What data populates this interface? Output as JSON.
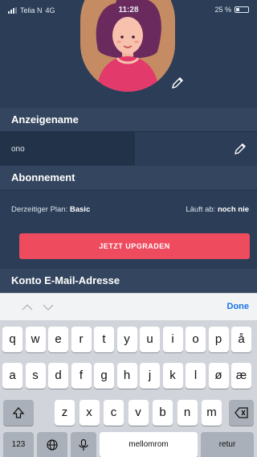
{
  "status": {
    "carrier": "Telia N",
    "network": "4G",
    "time": "11:28",
    "battery_pct": "25 %",
    "battery_level": 0.25
  },
  "profile": {
    "display_name_header": "Anzeigename",
    "display_name_value": "ono",
    "subscription_header": "Abonnement",
    "plan_label": "Derzeitiger Plan:",
    "plan_value": "Basic",
    "expires_label": "Läuft ab:",
    "expires_value": "noch nie",
    "upgrade_label": "JETZT UPGRADEN",
    "email_header": "Konto E-Mail-Adresse"
  },
  "keyboard": {
    "done_label": "Done",
    "row1": [
      "q",
      "w",
      "e",
      "r",
      "t",
      "y",
      "u",
      "i",
      "o",
      "p",
      "å"
    ],
    "row2": [
      "a",
      "s",
      "d",
      "f",
      "g",
      "h",
      "j",
      "k",
      "l",
      "ø",
      "æ"
    ],
    "row3": [
      "z",
      "x",
      "c",
      "v",
      "b",
      "n",
      "m"
    ],
    "numbers_label": "123",
    "space_label": "mellomrom",
    "return_label": "retur"
  },
  "colors": {
    "background": "#2b3d57",
    "upgrade_button": "#ef4b5e",
    "done": "#1a73e8"
  }
}
